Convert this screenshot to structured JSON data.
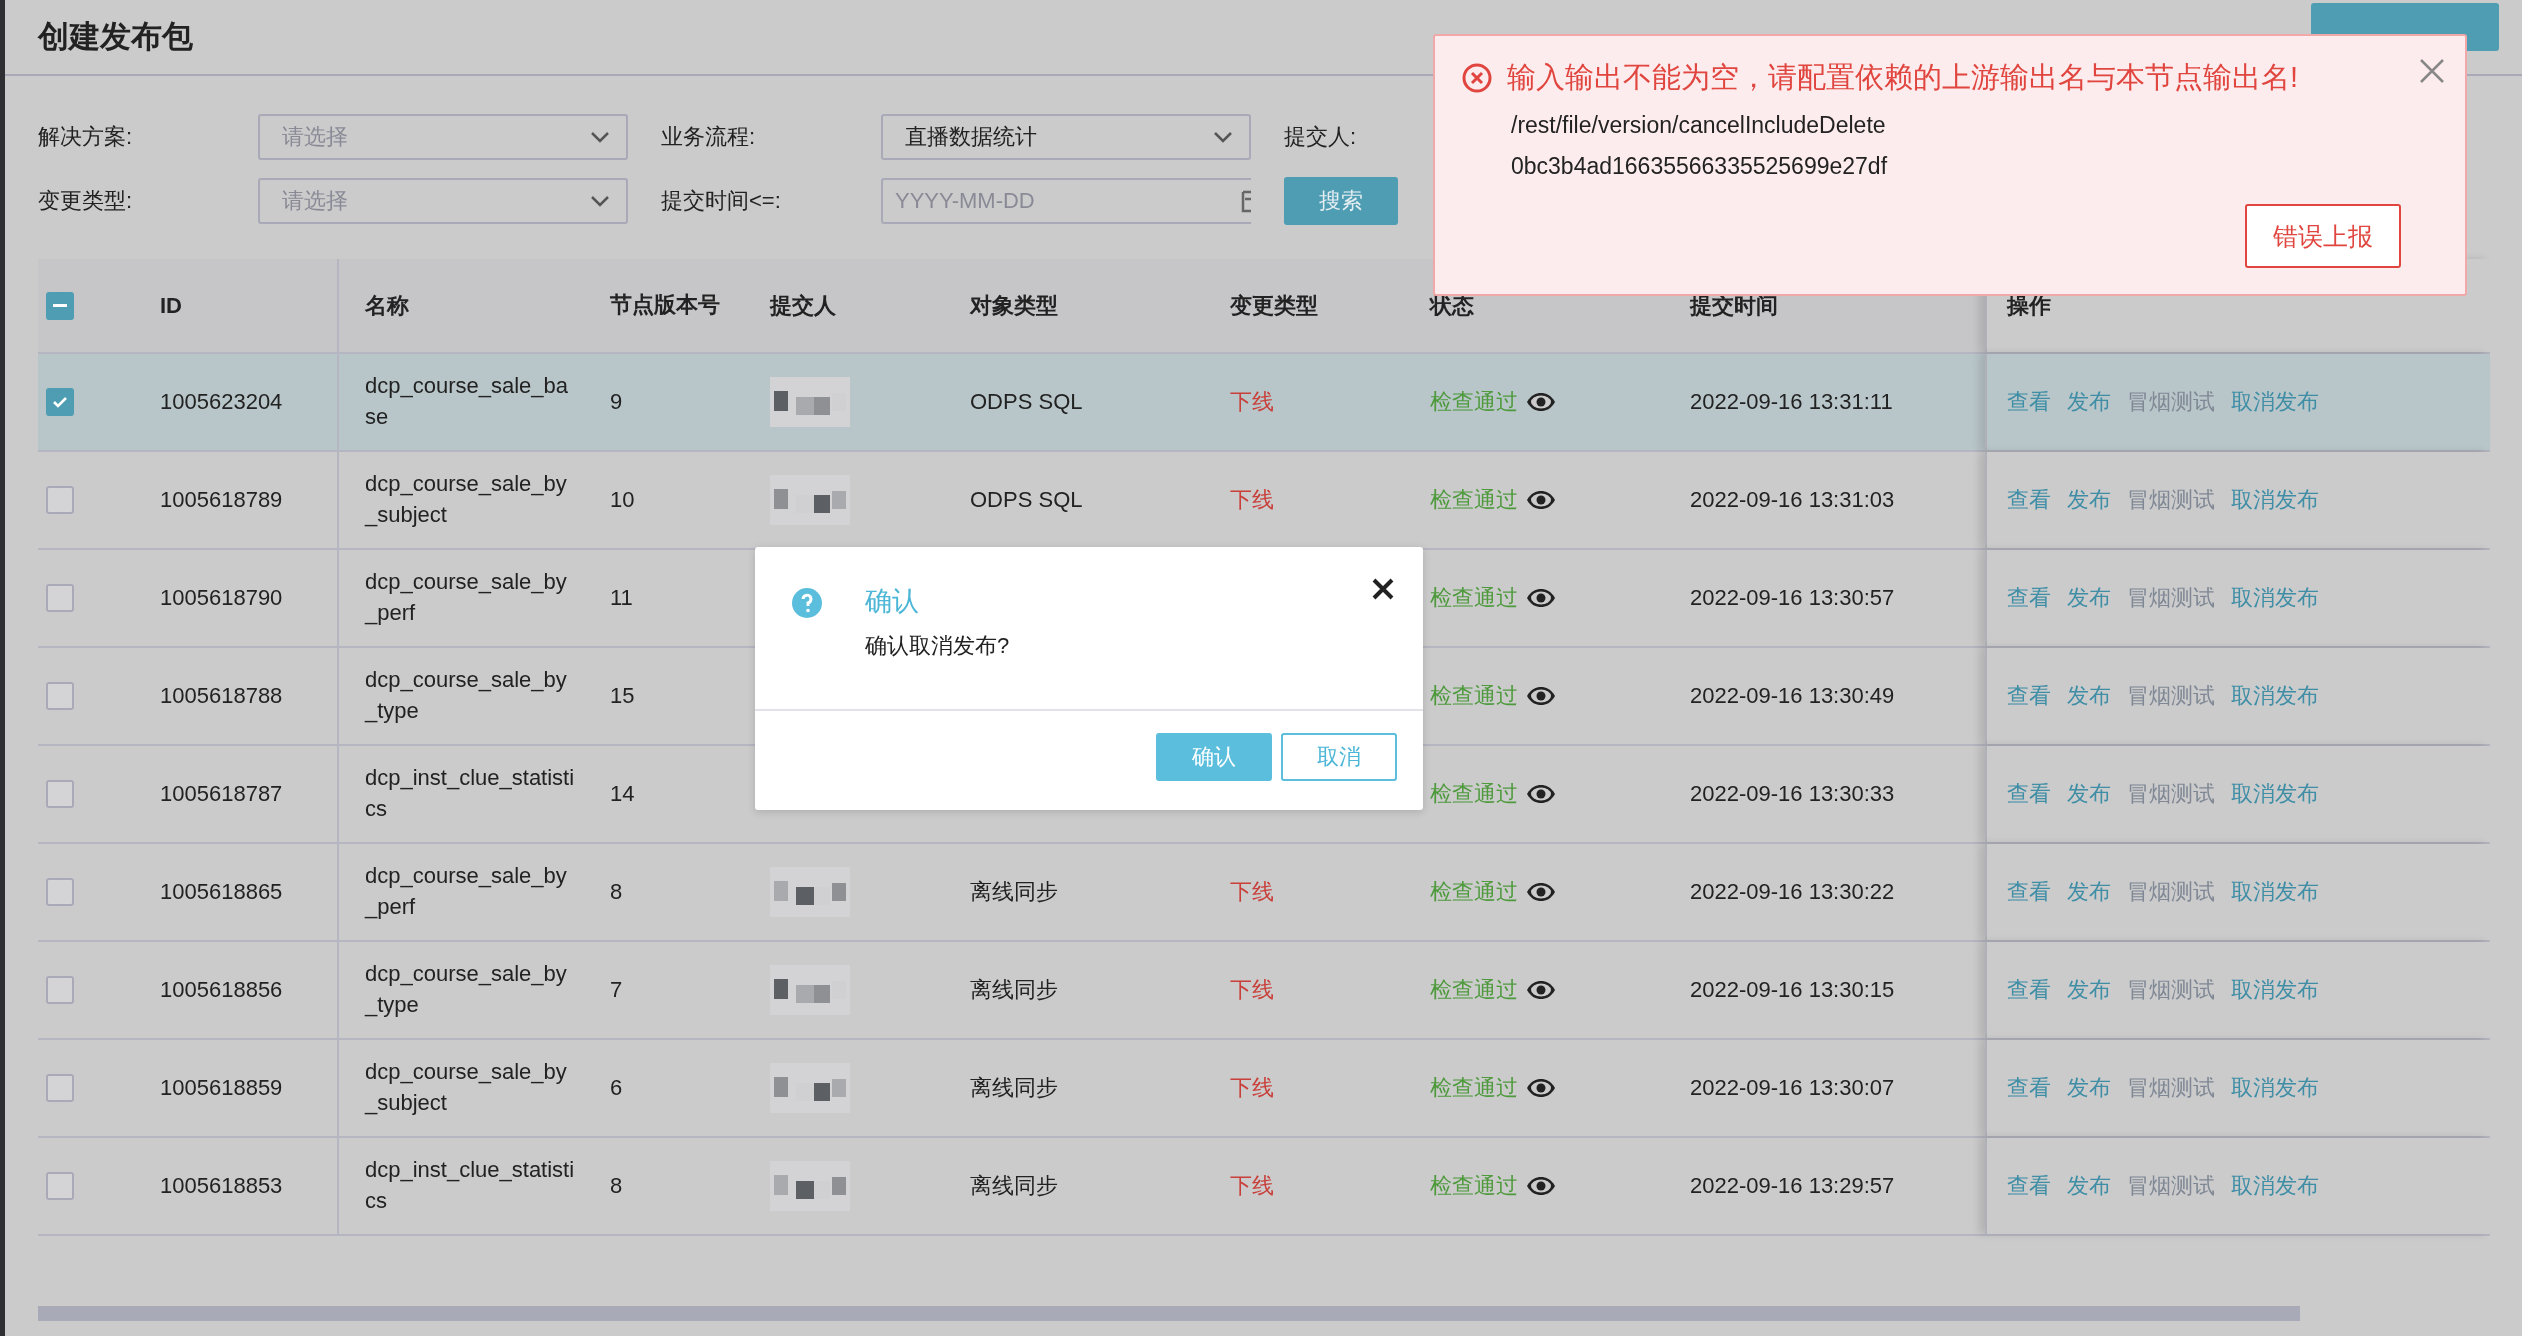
{
  "page_title": "创建发布包",
  "top_button": {
    "kind": "button"
  },
  "filters": [
    {
      "label": "解决方案:",
      "kind": "select",
      "placeholder": "请选择"
    },
    {
      "label": "业务流程:",
      "kind": "select",
      "value": "直播数据统计"
    },
    {
      "label": "提交人:",
      "kind": "text"
    },
    {
      "label": "变更类型:",
      "kind": "select",
      "placeholder": "请选择"
    },
    {
      "label": "提交时间<=:",
      "kind": "date",
      "placeholder": "YYYY-MM-DD"
    }
  ],
  "search_button": "搜索",
  "table": {
    "header_checkbox": {
      "indeterminate": true
    },
    "columns": [
      "ID",
      "名称",
      "节点版本号",
      "提交人",
      "对象类型",
      "变更类型",
      "状态",
      "提交时间",
      "操作"
    ],
    "rows": [
      {
        "selected": true,
        "id": "1005623204",
        "name": "dcp_course_sale_base",
        "version": "9",
        "submitter_shown": true,
        "object_type": "ODPS SQL",
        "change_type": "下线",
        "status": "检查通过",
        "time": "2022-09-16 13:31:11",
        "actions": [
          {
            "label": "查看",
            "disabled": false
          },
          {
            "label": "发布",
            "disabled": false
          },
          {
            "label": "冒烟测试",
            "disabled": true
          },
          {
            "label": "取消发布",
            "disabled": false
          }
        ]
      },
      {
        "selected": false,
        "id": "1005618789",
        "name": "dcp_course_sale_by_subject",
        "version": "10",
        "submitter_shown": true,
        "object_type": "ODPS SQL",
        "change_type": "下线",
        "status": "检查通过",
        "time": "2022-09-16 13:31:03",
        "actions": [
          {
            "label": "查看",
            "disabled": false
          },
          {
            "label": "发布",
            "disabled": false
          },
          {
            "label": "冒烟测试",
            "disabled": true
          },
          {
            "label": "取消发布",
            "disabled": false
          }
        ]
      },
      {
        "selected": false,
        "id": "1005618790",
        "name": "dcp_course_sale_by_perf",
        "version": "11",
        "submitter_shown": false,
        "status": "检查通过",
        "time": "2022-09-16 13:30:57",
        "actions": [
          {
            "label": "查看",
            "disabled": false
          },
          {
            "label": "发布",
            "disabled": false
          },
          {
            "label": "冒烟测试",
            "disabled": true
          },
          {
            "label": "取消发布",
            "disabled": false
          }
        ]
      },
      {
        "selected": false,
        "id": "1005618788",
        "name": "dcp_course_sale_by_type",
        "version": "15",
        "submitter_shown": false,
        "status": "检查通过",
        "time": "2022-09-16 13:30:49",
        "actions": [
          {
            "label": "查看",
            "disabled": false
          },
          {
            "label": "发布",
            "disabled": false
          },
          {
            "label": "冒烟测试",
            "disabled": true
          },
          {
            "label": "取消发布",
            "disabled": false
          }
        ]
      },
      {
        "selected": false,
        "id": "1005618787",
        "name": "dcp_inst_clue_statistics",
        "version": "14",
        "submitter_shown": false,
        "status": "检查通过",
        "time": "2022-09-16 13:30:33",
        "actions": [
          {
            "label": "查看",
            "disabled": false
          },
          {
            "label": "发布",
            "disabled": false
          },
          {
            "label": "冒烟测试",
            "disabled": true
          },
          {
            "label": "取消发布",
            "disabled": false
          }
        ]
      },
      {
        "selected": false,
        "id": "1005618865",
        "name": "dcp_course_sale_by_perf",
        "version": "8",
        "submitter_shown": true,
        "object_type": "离线同步",
        "change_type": "下线",
        "status": "检查通过",
        "time": "2022-09-16 13:30:22",
        "actions": [
          {
            "label": "查看",
            "disabled": false
          },
          {
            "label": "发布",
            "disabled": false
          },
          {
            "label": "冒烟测试",
            "disabled": true
          },
          {
            "label": "取消发布",
            "disabled": false
          }
        ]
      },
      {
        "selected": false,
        "id": "1005618856",
        "name": "dcp_course_sale_by_type",
        "version": "7",
        "submitter_shown": true,
        "object_type": "离线同步",
        "change_type": "下线",
        "status": "检查通过",
        "time": "2022-09-16 13:30:15",
        "actions": [
          {
            "label": "查看",
            "disabled": false
          },
          {
            "label": "发布",
            "disabled": false
          },
          {
            "label": "冒烟测试",
            "disabled": true
          },
          {
            "label": "取消发布",
            "disabled": false
          }
        ]
      },
      {
        "selected": false,
        "id": "1005618859",
        "name": "dcp_course_sale_by_subject",
        "version": "6",
        "submitter_shown": true,
        "object_type": "离线同步",
        "change_type": "下线",
        "status": "检查通过",
        "time": "2022-09-16 13:30:07",
        "actions": [
          {
            "label": "查看",
            "disabled": false
          },
          {
            "label": "发布",
            "disabled": false
          },
          {
            "label": "冒烟测试",
            "disabled": true
          },
          {
            "label": "取消发布",
            "disabled": false
          }
        ]
      },
      {
        "selected": false,
        "id": "1005618853",
        "name": "dcp_inst_clue_statistics",
        "version": "8",
        "submitter_shown": true,
        "object_type": "离线同步",
        "change_type": "下线",
        "status": "检查通过",
        "time": "2022-09-16 13:29:57",
        "actions": [
          {
            "label": "查看",
            "disabled": false
          },
          {
            "label": "发布",
            "disabled": false
          },
          {
            "label": "冒烟测试",
            "disabled": true
          },
          {
            "label": "取消发布",
            "disabled": false
          }
        ]
      }
    ]
  },
  "error_toast": {
    "title": "输入输出不能为空，请配置依赖的上游输出名与本节点输出名!",
    "lines": [
      "/rest/file/version/cancelIncludeDelete",
      "0bc3b4ad16635566335525699e27df"
    ],
    "report_button": "错误上报"
  },
  "dialog": {
    "title": "确认",
    "message": "确认取消发布?",
    "buttons": [
      {
        "label": "确认",
        "kind": "primary"
      },
      {
        "label": "取消",
        "kind": "default"
      }
    ]
  }
}
